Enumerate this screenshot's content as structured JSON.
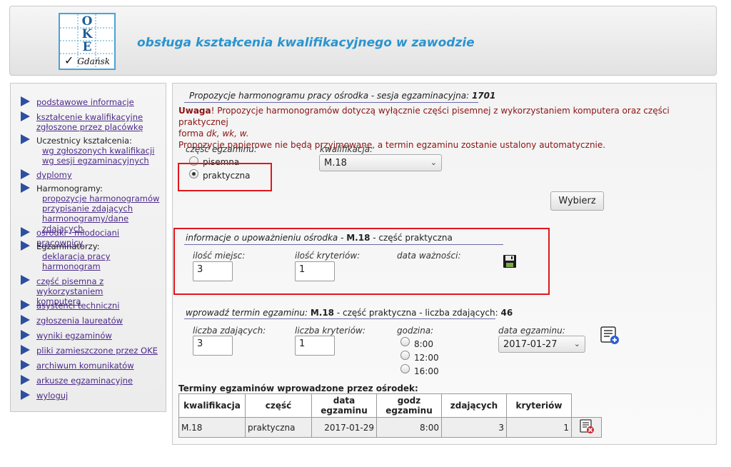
{
  "header": {
    "logo_letters": [
      "O",
      "K",
      "E"
    ],
    "logo_city": "Gdańsk",
    "title": "obsługa kształcenia kwalifikacyjnego w zawodzie"
  },
  "sidebar": {
    "items": [
      {
        "label": "podstawowe informacje",
        "link": true
      },
      {
        "label": "kształcenie kwalifikacyjne",
        "label2": "zgłoszone przez placówkę",
        "link": true
      },
      {
        "label": "Uczestnicy kształcenia:",
        "link": false,
        "subs": [
          "wg zgłoszonych kwalifikacji",
          "wg sesji egzaminacyjnych"
        ]
      },
      {
        "label": "dyplomy",
        "link": true
      },
      {
        "label": "Harmonogramy:",
        "link": false,
        "subs": [
          "propozycje harmonogramów",
          "przypisanie zdających",
          "harmonogramy/dane zdających"
        ]
      },
      {
        "label": "ośrodki - młodociani pracownicy",
        "link": true
      },
      {
        "label": "Egzaminatorzy:",
        "link": false,
        "subs": [
          "deklaracja pracy",
          "harmonogram"
        ]
      },
      {
        "label": "część pisemna z wykorzystaniem",
        "label2": "komputera",
        "link": true
      },
      {
        "label": "asystenci techniczni",
        "link": true
      },
      {
        "label": "zgłoszenia laureatów",
        "link": true
      },
      {
        "label": "wyniki egzaminów",
        "link": true
      },
      {
        "label": "pliki zamieszczone przez OKE",
        "link": true
      },
      {
        "label": "archiwum komunikatów",
        "link": true
      },
      {
        "label": "arkusze egzaminacyjne",
        "link": true
      },
      {
        "label": "wyloguj",
        "link": true
      }
    ]
  },
  "main": {
    "section_title": "Propozycje harmonogramu pracy ośrodka - sesja egzaminacyjna: ",
    "session": "1701",
    "warning_label": "Uwaga",
    "warning_line1": "! Propozycje harmonogramów dotyczą wyłącznie części pisemnej z wykorzystaniem komputera oraz części praktycznej",
    "warning_line2_prefix": "forma ",
    "warning_line2_forms": "dk, wk, w.",
    "warning_line3": "Propozycje papierowe nie będą przyjmowane, a termin egzaminu zostanie ustalony automatycznie.",
    "part_label": "część egzaminu:",
    "part_options": [
      "pisemna",
      "praktyczna"
    ],
    "part_selected": "praktyczna",
    "qual_label": "kwalifikacja:",
    "qual_value": "M.18",
    "choose_button": "Wybierz",
    "auth": {
      "title_prefix": "informacje o upoważnieniu ośrodka - ",
      "qual": "M.18",
      "title_suffix": " - część praktyczna",
      "places_label": "ilość miejsc:",
      "places_value": "3",
      "criteria_label": "ilość kryteriów:",
      "criteria_value": "1",
      "validity_label": "data ważności:"
    },
    "term": {
      "title_prefix": "wprowadź termin egzaminu: ",
      "qual": "M.18",
      "title_mid": " - część praktyczna - liczba zdających: ",
      "count": "46",
      "students_label": "liczba zdających:",
      "students_value": "3",
      "criteria_label": "liczba kryteriów:",
      "criteria_value": "1",
      "hour_label": "godzina:",
      "hours": [
        "8:00",
        "12:00",
        "16:00"
      ],
      "date_label": "data egzaminu:",
      "date_value": "2017-01-27"
    },
    "table": {
      "caption": "Terminy egzaminów wprowadzone przez ośrodek:",
      "headers": [
        "kwalifikacja",
        "część",
        "data egzaminu",
        "godz egzaminu",
        "zdających",
        "kryteriów"
      ],
      "rows": [
        [
          "M.18",
          "praktyczna",
          "2017-01-29",
          "8:00",
          "3",
          "1"
        ]
      ]
    }
  }
}
